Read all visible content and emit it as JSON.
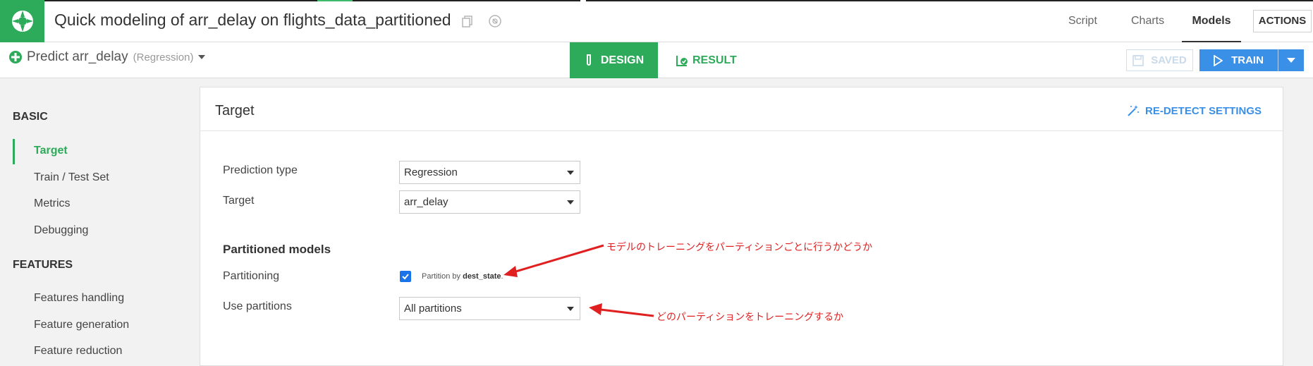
{
  "header": {
    "title": "Quick modeling of arr_delay on flights_data_partitioned",
    "nav_tabs": [
      {
        "label": "Script"
      },
      {
        "label": "Charts"
      },
      {
        "label": "Models"
      }
    ],
    "actions_label": "ACTIONS"
  },
  "subbar": {
    "predict_title": "Predict arr_delay",
    "predict_type": "(Regression)",
    "tab_design": "DESIGN",
    "tab_result": "RESULT",
    "saved_label": "SAVED",
    "train_label": "TRAIN"
  },
  "sidebar": {
    "basic_heading": "BASIC",
    "basic_items": [
      {
        "label": "Target"
      },
      {
        "label": "Train / Test Set"
      },
      {
        "label": "Metrics"
      },
      {
        "label": "Debugging"
      }
    ],
    "features_heading": "FEATURES",
    "features_items": [
      {
        "label": "Features handling"
      },
      {
        "label": "Feature generation"
      },
      {
        "label": "Feature reduction"
      }
    ]
  },
  "card": {
    "title": "Target",
    "redetect_label": "RE-DETECT SETTINGS",
    "prediction_type_label": "Prediction type",
    "prediction_type_value": "Regression",
    "target_label": "Target",
    "target_value": "arr_delay",
    "partitioned_title": "Partitioned models",
    "partitioning_label": "Partitioning",
    "partition_by_prefix": "Partition by",
    "partition_by_column": "dest_state",
    "partition_by_suffix": ".",
    "use_partitions_label": "Use partitions",
    "use_partitions_value": "All partitions"
  },
  "annotations": {
    "partitioning_note": "モデルのトレーニングをパーティションごとに行うかどうか",
    "use_partitions_note": "どのパーティションをトレーニングするか"
  },
  "colors": {
    "brand_green": "#2eaa5b",
    "accent_blue": "#3a8fe6",
    "annotation_red": "#e02020"
  }
}
